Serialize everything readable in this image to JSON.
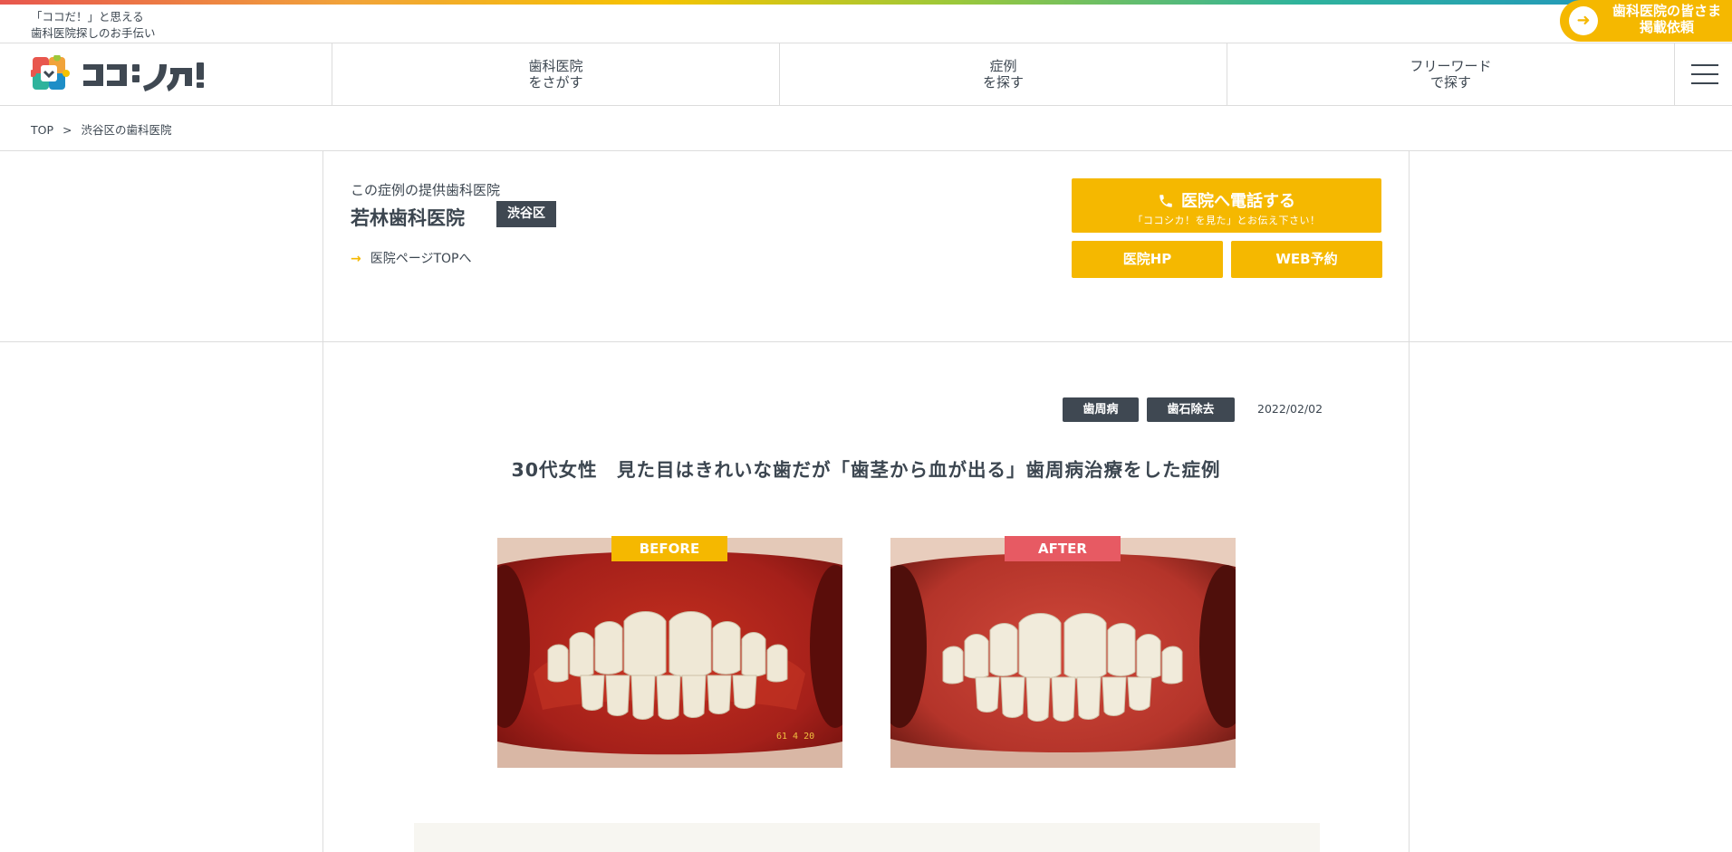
{
  "header": {
    "tagline_line1": "「ココだ！」と思える",
    "tagline_line2": "歯科医院探しのお手伝い",
    "listing_cta_line1": "歯科医院の皆さま",
    "listing_cta_line2": "掲載依頼",
    "listing_cta_icon": "arrow-right-icon",
    "logo_alt": "ココシカ!",
    "nav": [
      {
        "label": "歯科医院\nをさがす"
      },
      {
        "label": "症例\nを探す"
      },
      {
        "label": "フリーワード\nで探す"
      }
    ],
    "menu_icon": "hamburger-icon"
  },
  "breadcrumb": {
    "items": [
      "TOP",
      "渋谷区の歯科医院"
    ],
    "separator": ">"
  },
  "clinic": {
    "subtitle": "この症例の提供歯科医院",
    "name": "若林歯科医院",
    "area": "渋谷区",
    "top_link": "医院ページTOPへ",
    "link_arrow": "→",
    "call_button": "医院へ電話する",
    "call_note": "「ココシカ！を見た」とお伝え下さい！",
    "hp_button": "医院HP",
    "web_button": "WEB予約"
  },
  "case": {
    "tags": [
      "歯周病",
      "歯石除去"
    ],
    "date": "2022/02/02",
    "title": "30代女性　見た目はきれいな歯だが「歯茎から血が出る」歯周病治療をした症例",
    "before_label": "BEFORE",
    "after_label": "AFTER",
    "before_date_stamp": "61  4  20"
  },
  "colors": {
    "accent": "#f5b800",
    "dark": "#3f4852",
    "after": "#e75a63",
    "text": "#3c4650"
  }
}
